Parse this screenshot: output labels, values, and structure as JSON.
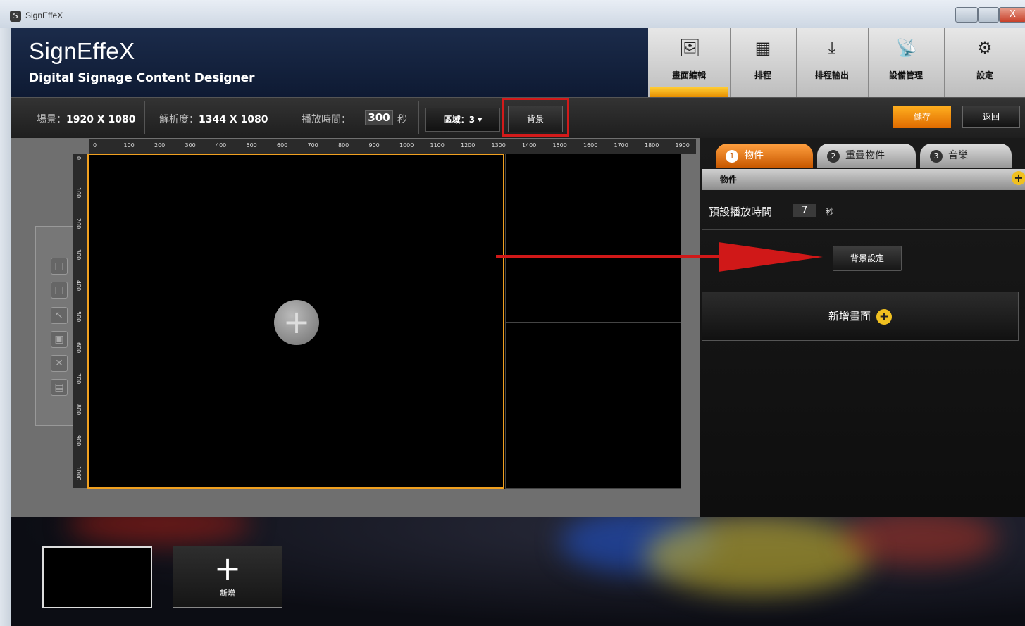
{
  "window": {
    "title": "SignEffeX",
    "close_glyph": "X"
  },
  "app": {
    "brand": "SignEffeX",
    "subtitle": "Digital Signage Content Designer"
  },
  "nav": {
    "items": [
      {
        "label": "畫面編輯",
        "icon": "image-edit-icon",
        "active": true
      },
      {
        "label": "排程",
        "icon": "calendar-icon"
      },
      {
        "label": "排程輸出",
        "icon": "download-icon"
      },
      {
        "label": "設備管理",
        "icon": "device-icon"
      },
      {
        "label": "設定",
        "icon": "gear-icon"
      }
    ]
  },
  "toolbar": {
    "scene_label": "場景：",
    "scene_value": "1920 X 1080",
    "resolution_label": "解析度：",
    "resolution_value": "1344 X 1080",
    "duration_label": "播放時間：",
    "duration_value": "300",
    "duration_unit": "秒",
    "region_label": "區域：3 ▾",
    "background_button": "背景",
    "save_button": "儲存",
    "back_button": "返回"
  },
  "ruler": {
    "h": [
      "0",
      "100",
      "200",
      "300",
      "400",
      "500",
      "600",
      "700",
      "800",
      "900",
      "1000",
      "1100",
      "1200",
      "1300",
      "1400",
      "1500",
      "1600",
      "1700",
      "1800",
      "1900"
    ],
    "v": [
      "0",
      "100",
      "200",
      "300",
      "400",
      "500",
      "600",
      "700",
      "800",
      "900",
      "1000"
    ]
  },
  "canvas": {
    "plus_glyph": "+"
  },
  "tools": [
    "□",
    "□",
    "↖",
    "▣",
    "✕",
    "▤"
  ],
  "panel": {
    "tabs": [
      {
        "num": "1",
        "label": "物件"
      },
      {
        "num": "2",
        "label": "重疊物件"
      },
      {
        "num": "3",
        "label": "音樂"
      }
    ],
    "section_header": "物件",
    "preset_label": "預設播放時間",
    "preset_value": "7",
    "preset_unit": "秒",
    "bg_setting_button": "背景設定",
    "add_screen_label": "新增畫面",
    "plus_glyph": "+"
  },
  "bottom": {
    "add_label": "新增",
    "add_glyph": "+"
  },
  "colors": {
    "accent": "#f0a020",
    "highlight": "#d21a1a",
    "header": "#1b2b4a"
  }
}
